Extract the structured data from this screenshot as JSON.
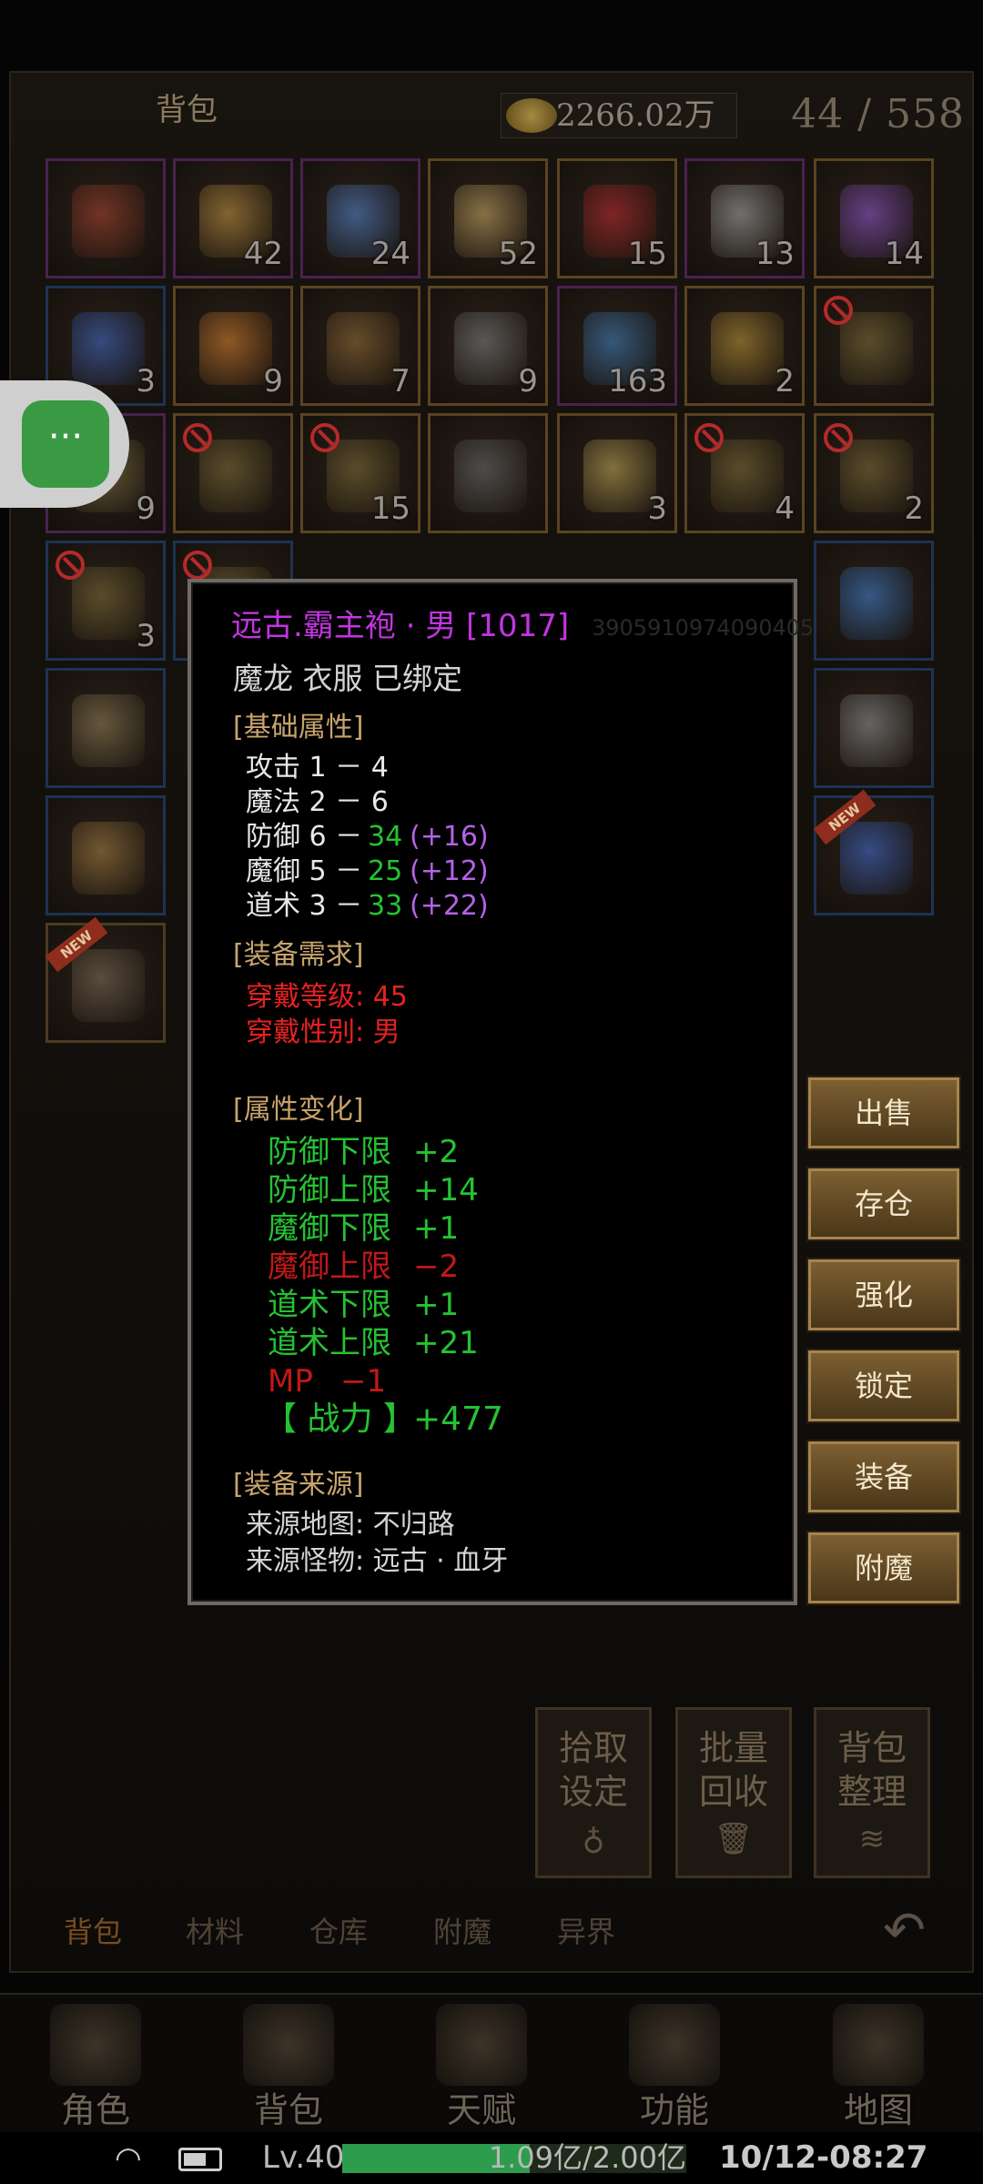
{
  "header": {
    "tab_title": "背包",
    "gold": "2266.02万",
    "capacity": "44 / 558"
  },
  "slots": {
    "r1": [
      {
        "count": "",
        "color": "#8a3a2a",
        "icon": "treasure-chest-icon"
      },
      {
        "count": "42",
        "color": "#a07a3a",
        "icon": "scroll-icon"
      },
      {
        "count": "24",
        "color": "#4a6ea8",
        "icon": "map-scroll-icon"
      },
      {
        "count": "52",
        "color": "#a58a55",
        "icon": "gourd-icon"
      },
      {
        "count": "15",
        "color": "#9a2828",
        "icon": "red-orb-icon"
      },
      {
        "count": "13",
        "color": "#8a8a8a",
        "icon": "jade-disc-icon"
      },
      {
        "count": "14",
        "color": "#7a4aa8",
        "icon": "purple-gem-icon"
      }
    ],
    "r2": [
      {
        "count": "3",
        "color": "#3a58a0",
        "icon": "blue-talisman-icon"
      },
      {
        "count": "9",
        "color": "#b06a2a",
        "icon": "orange-talisman-icon"
      },
      {
        "count": "7",
        "color": "#7a5a30",
        "icon": "key-icon"
      },
      {
        "count": "9",
        "color": "#6a6a6a",
        "icon": "whistle-icon"
      },
      {
        "count": "163",
        "color": "#3a6a9a",
        "icon": "crystal-icon"
      },
      {
        "count": "2",
        "color": "#9a7a30",
        "icon": "scroll-bundle-icon"
      },
      {
        "count": "",
        "color": "#6a5a30",
        "icon": "skill-book-icon",
        "forbid": true
      }
    ],
    "r3": [
      {
        "count": "9",
        "color": "#7a6a40",
        "icon": "book-icon"
      },
      {
        "count": "",
        "color": "#6a5a30",
        "icon": "skill-book-icon",
        "forbid": true
      },
      {
        "count": "15",
        "color": "#6a5a30",
        "icon": "skill-book-icon",
        "forbid": true
      },
      {
        "count": "",
        "color": "#5a5a5a",
        "icon": "dagger-icon"
      },
      {
        "count": "3",
        "color": "#a08a4a",
        "icon": "golden-book-icon"
      },
      {
        "count": "4",
        "color": "#6a5a30",
        "icon": "skill-book-icon",
        "forbid": true
      },
      {
        "count": "2",
        "color": "#6a5a30",
        "icon": "skill-book-icon",
        "forbid": true
      }
    ],
    "r4": [
      {
        "count": "3",
        "color": "#6a5a30",
        "icon": "skill-book-icon",
        "forbid": true
      },
      {
        "count": "",
        "color": "#6a5a30",
        "icon": "skill-book-icon",
        "forbid": true
      },
      {
        "count": "",
        "color": "#3a6aa8",
        "icon": "blue-ring-icon"
      }
    ],
    "r5": [
      {
        "count": "",
        "color": "#7a6a4a",
        "icon": "boots-icon"
      },
      {
        "count": "",
        "color": "#7a7a7a",
        "icon": "armor-icon"
      }
    ],
    "r6": [
      {
        "count": "",
        "color": "#8a6a3a",
        "icon": "medallion-icon"
      },
      {
        "count": "",
        "color": "#3a5aa8",
        "icon": "sapphire-ring-icon",
        "new": true
      }
    ],
    "r7": [
      {
        "count": "",
        "color": "#6a5a4a",
        "icon": "ring-icon",
        "new": true
      }
    ],
    "new_label": "NEW"
  },
  "tooltip": {
    "name": "远古.霸主袍 · 男 [1017]",
    "ghost_id": "3905910974090405",
    "subtitle": "魔龙 衣服 已绑定",
    "base_header": "[基础属性]",
    "base": [
      {
        "label": "攻击 1 － 4",
        "value": "",
        "bonus": ""
      },
      {
        "label": "魔法 2 － 6",
        "value": "",
        "bonus": ""
      },
      {
        "label": "防御 6 －",
        "value": "34",
        "bonus": "(+16)"
      },
      {
        "label": "魔御 5 －",
        "value": "25",
        "bonus": "(+12)"
      },
      {
        "label": "道术 3 －",
        "value": "33",
        "bonus": "(+22)"
      }
    ],
    "req_header": "[装备需求]",
    "req_level": "穿戴等级: 45",
    "req_gender": "穿戴性别: 男",
    "change_header": "[属性变化]",
    "changes": [
      {
        "label": "防御下限",
        "value": "+2",
        "color": "#25c232"
      },
      {
        "label": "防御上限",
        "value": "+14",
        "color": "#25c232"
      },
      {
        "label": "魔御下限",
        "value": "+1",
        "color": "#25c232"
      },
      {
        "label": "魔御上限",
        "value": "−2",
        "color": "#c21818"
      },
      {
        "label": "道术下限",
        "value": "+1",
        "color": "#25c232"
      },
      {
        "label": "道术上限",
        "value": "+21",
        "color": "#25c232"
      },
      {
        "label": "MP",
        "value": "−1",
        "color": "#c21818"
      }
    ],
    "power_label": "【 战力 】",
    "power_value": "+477",
    "source_header": "[装备来源]",
    "source_map": "来源地图:   不归路",
    "source_monster": "来源怪物:   远古 · 血牙"
  },
  "actions": [
    "出售",
    "存仓",
    "强化",
    "锁定",
    "装备",
    "附魔"
  ],
  "bottom_buttons": [
    {
      "line1": "拾取",
      "line2": "设定",
      "glyph": "♁"
    },
    {
      "line1": "批量",
      "line2": "回收",
      "glyph": "🗑"
    },
    {
      "line1": "背包",
      "line2": "整理",
      "glyph": "≋"
    }
  ],
  "categories": [
    "背包",
    "材料",
    "仓库",
    "附魔",
    "异界"
  ],
  "nav": [
    "角色",
    "背包",
    "天赋",
    "功能",
    "地图"
  ],
  "status": {
    "level": "Lv.40",
    "xp_text": "1.09亿/2.00亿",
    "xp_fraction": 0.545,
    "clock": "10/12-08:27"
  }
}
